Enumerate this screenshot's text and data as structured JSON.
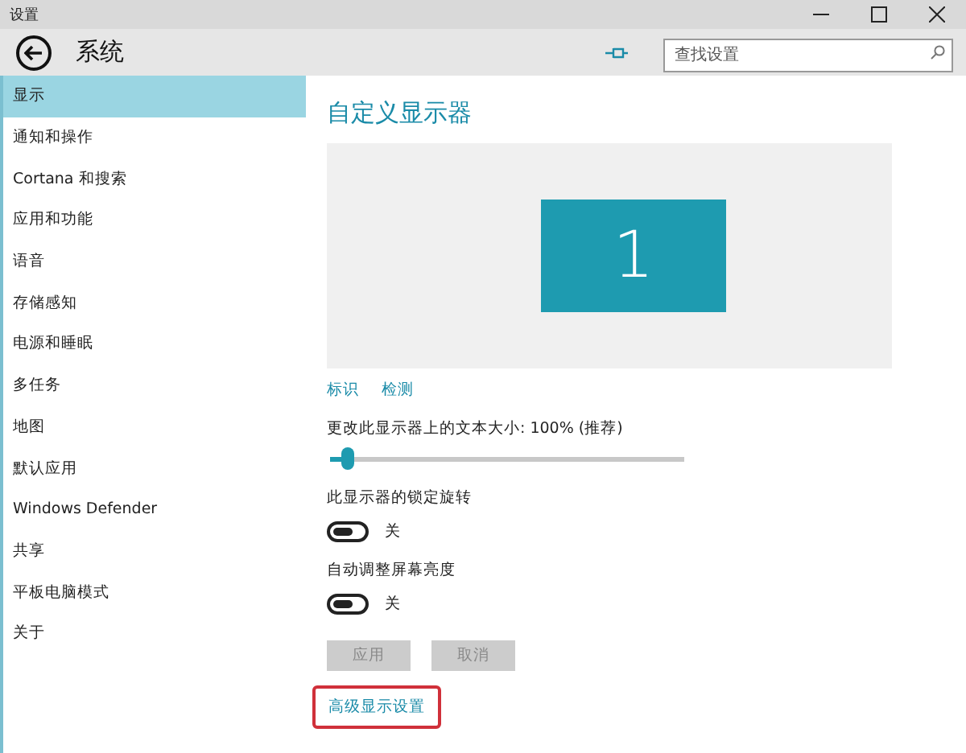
{
  "window": {
    "title": "设置"
  },
  "header": {
    "title": "系统",
    "search": {
      "placeholder": "查找设置"
    }
  },
  "sidebar": {
    "items": [
      {
        "label": "显示",
        "selected": true
      },
      {
        "label": "通知和操作",
        "selected": false
      },
      {
        "label": "Cortana 和搜索",
        "selected": false
      },
      {
        "label": "应用和功能",
        "selected": false
      },
      {
        "label": "语音",
        "selected": false
      },
      {
        "label": "存储感知",
        "selected": false
      },
      {
        "label": "电源和睡眠",
        "selected": false
      },
      {
        "label": "多任务",
        "selected": false
      },
      {
        "label": "地图",
        "selected": false
      },
      {
        "label": "默认应用",
        "selected": false
      },
      {
        "label": "Windows Defender",
        "selected": false
      },
      {
        "label": "共享",
        "selected": false
      },
      {
        "label": "平板电脑模式",
        "selected": false
      },
      {
        "label": "关于",
        "selected": false
      }
    ]
  },
  "content": {
    "heading": "自定义显示器",
    "monitor": {
      "number": "1"
    },
    "links": [
      "标识",
      "检测"
    ],
    "scale": {
      "label": "更改此显示器上的文本大小: 100% (推荐)",
      "level": 0.05
    },
    "toggles": [
      {
        "label": "此显示器的锁定旋转",
        "on": false,
        "state": "关"
      },
      {
        "label": "自动调整屏幕亮度",
        "on": false,
        "state": "关"
      }
    ],
    "buttons": [
      {
        "label": "应用",
        "disabled": true
      },
      {
        "label": "取消",
        "disabled": true
      }
    ],
    "advanced_link": {
      "label": "高级显示设置",
      "highlighted": true
    }
  }
}
